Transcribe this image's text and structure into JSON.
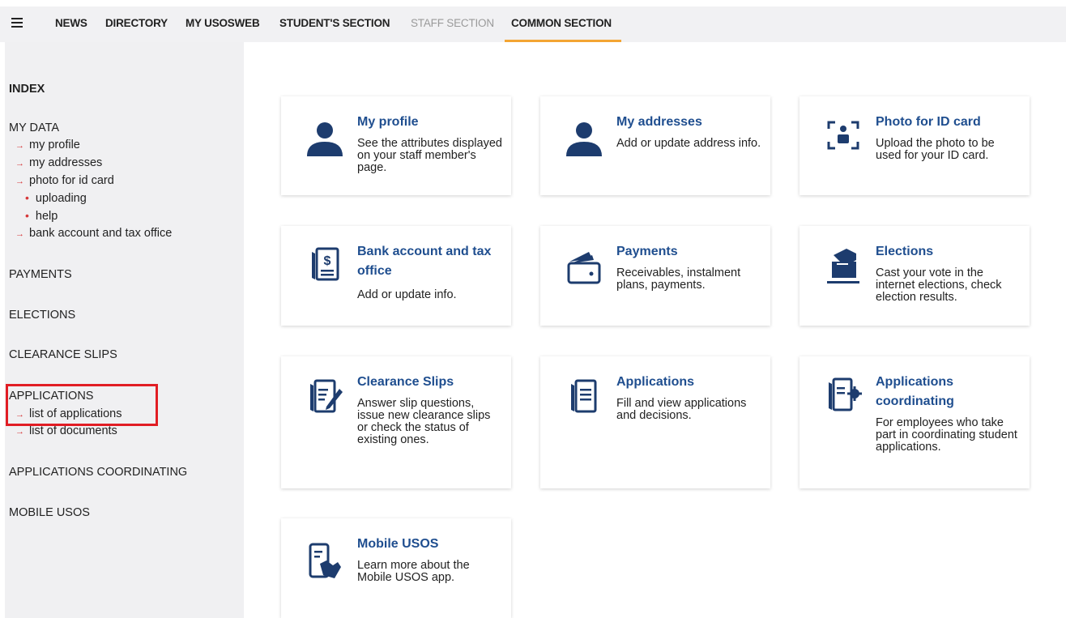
{
  "nav": {
    "items": [
      "NEWS",
      "DIRECTORY",
      "MY USOSWEB",
      "STUDENT'S SECTION",
      "STAFF SECTION",
      "COMMON SECTION"
    ]
  },
  "sidebar": {
    "index": "INDEX",
    "my_data": "MY DATA",
    "my_profile": "my profile",
    "my_addresses": "my addresses",
    "photo_for_id_card": "photo for id card",
    "uploading": "uploading",
    "help": "help",
    "bank_account": "bank account and tax office",
    "payments": "PAYMENTS",
    "elections": "ELECTIONS",
    "clearance_slips": "CLEARANCE SLIPS",
    "applications": "APPLICATIONS",
    "list_of_applications": "list of applications",
    "list_of_documents": "list of documents",
    "applications_coordinating": "APPLICATIONS COORDINATING",
    "mobile_usos": "MOBILE USOS"
  },
  "cards": {
    "my_profile": {
      "title": "My profile",
      "desc": "See the attributes displayed on your staff member's page."
    },
    "my_addresses": {
      "title": "My addresses",
      "desc": "Add or update address info."
    },
    "photo_id": {
      "title": "Photo for ID card",
      "desc": "Upload the photo to be used for your ID card."
    },
    "bank": {
      "title": "Bank account and tax office",
      "desc": "Add or update info."
    },
    "payments": {
      "title": "Payments",
      "desc": "Receivables, instalment plans, payments."
    },
    "elections": {
      "title": "Elections",
      "desc": "Cast your vote in the internet elections, check election results."
    },
    "clearance": {
      "title": "Clearance Slips",
      "desc": "Answer slip questions, issue new clearance slips or check the status of existing ones."
    },
    "applications": {
      "title": "Applications",
      "desc": "Fill and view applications and decisions."
    },
    "coordinating": {
      "title": "Applications coordinating",
      "desc": "For employees who take part in coordinating student applications."
    },
    "mobile": {
      "title": "Mobile USOS",
      "desc": "Learn more about the Mobile USOS app."
    }
  },
  "colors": {
    "accent": "#f3a533",
    "link_title": "#1f4e8f",
    "icon": "#1d3c6e",
    "arrow": "#d6383a",
    "highlight": "#e11d24"
  },
  "icons": [
    "menu-icon",
    "person-icon",
    "photo-id-icon",
    "dollar-document-icon",
    "wallet-icon",
    "ballot-box-icon",
    "edit-document-icon",
    "document-icon",
    "document-gear-icon",
    "phone-hand-icon"
  ]
}
